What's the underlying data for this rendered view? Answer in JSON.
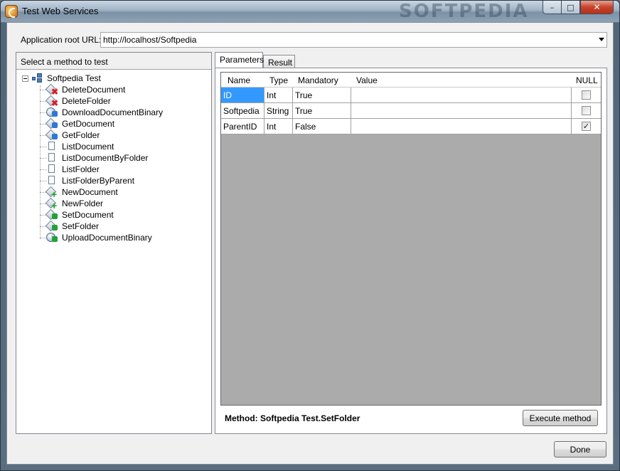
{
  "window": {
    "title": "Test Web Services",
    "background_watermark": "SOFTPEDIA",
    "buttons": {
      "minimize": "–",
      "maximize": "□",
      "close": "✕"
    }
  },
  "url": {
    "label": "Application root URL:",
    "value": "http://localhost/Softpedia"
  },
  "method_panel": {
    "header": "Select a method to test",
    "root": "Softpedia Test",
    "methods": [
      {
        "label": "DeleteDocument",
        "icon": "delete-method-icon"
      },
      {
        "label": "DeleteFolder",
        "icon": "delete-method-icon"
      },
      {
        "label": "DownloadDocumentBinary",
        "icon": "download-method-icon"
      },
      {
        "label": "GetDocument",
        "icon": "get-method-icon"
      },
      {
        "label": "GetFolder",
        "icon": "get-method-icon"
      },
      {
        "label": "ListDocument",
        "icon": "list-method-icon"
      },
      {
        "label": "ListDocumentByFolder",
        "icon": "list-method-icon"
      },
      {
        "label": "ListFolder",
        "icon": "list-method-icon"
      },
      {
        "label": "ListFolderByParent",
        "icon": "list-method-icon"
      },
      {
        "label": "NewDocument",
        "icon": "new-method-icon"
      },
      {
        "label": "NewFolder",
        "icon": "new-method-icon"
      },
      {
        "label": "SetDocument",
        "icon": "set-method-icon"
      },
      {
        "label": "SetFolder",
        "icon": "set-method-icon"
      },
      {
        "label": "UploadDocumentBinary",
        "icon": "upload-method-icon"
      }
    ]
  },
  "tabs": {
    "parameters": "Parameters",
    "result": "Result",
    "active": "Parameters"
  },
  "grid": {
    "columns": [
      "Name",
      "Type",
      "Mandatory",
      "Value",
      "NULL"
    ],
    "rows": [
      {
        "name": "ID",
        "type": "Int",
        "mandatory": "True",
        "value": "",
        "null": false,
        "selected": true
      },
      {
        "name": "Softpedia",
        "type": "String",
        "mandatory": "True",
        "value": "",
        "null": false,
        "selected": false
      },
      {
        "name": "ParentID",
        "type": "Int",
        "mandatory": "False",
        "value": "",
        "null": true,
        "selected": false
      }
    ]
  },
  "method_info": "Method: Softpedia Test.SetFolder",
  "buttons": {
    "execute": "Execute method",
    "done": "Done"
  },
  "colors": {
    "selection": "#3399ff",
    "grid_background": "#ababab"
  }
}
